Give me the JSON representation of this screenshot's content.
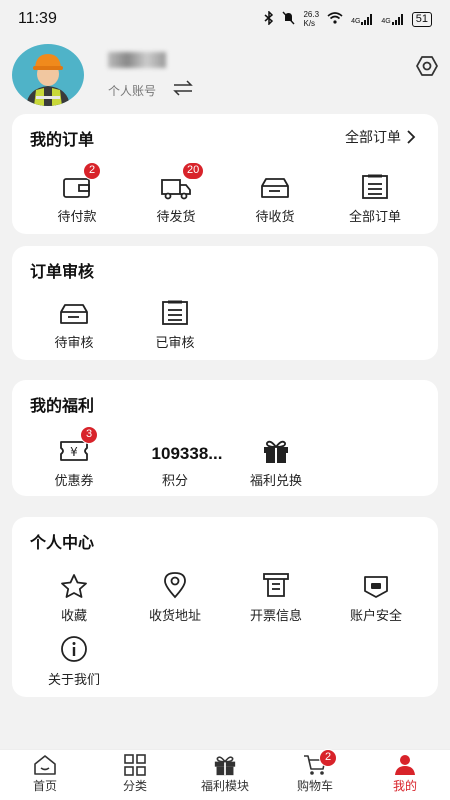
{
  "status_bar": {
    "time": "11:39",
    "net_speed_top": "26.3",
    "net_speed_bottom": "K/s",
    "signal1": "4G",
    "signal2": "4G",
    "battery": "51"
  },
  "profile": {
    "account_label": "个人账号"
  },
  "my_orders": {
    "title": "我的订单",
    "view_all": "全部订单",
    "items": [
      {
        "label": "待付款",
        "badge": "2"
      },
      {
        "label": "待发货",
        "badge": "20"
      },
      {
        "label": "待收货"
      },
      {
        "label": "全部订单"
      }
    ]
  },
  "order_review": {
    "title": "订单审核",
    "items": [
      {
        "label": "待审核"
      },
      {
        "label": "已审核"
      }
    ]
  },
  "my_benefits": {
    "title": "我的福利",
    "coupon": {
      "label": "优惠券",
      "badge": "3"
    },
    "points": {
      "value": "109338...",
      "label": "积分"
    },
    "exchange": {
      "label": "福利兑换"
    }
  },
  "personal_center": {
    "title": "个人中心",
    "items": [
      {
        "label": "收藏"
      },
      {
        "label": "收货地址"
      },
      {
        "label": "开票信息"
      },
      {
        "label": "账户安全"
      },
      {
        "label": "关于我们"
      }
    ]
  },
  "tabbar": {
    "tabs": [
      {
        "label": "首页"
      },
      {
        "label": "分类"
      },
      {
        "label": "福利模块"
      },
      {
        "label": "购物车",
        "badge": "2"
      },
      {
        "label": "我的"
      }
    ],
    "active_color": "#d8232a"
  }
}
